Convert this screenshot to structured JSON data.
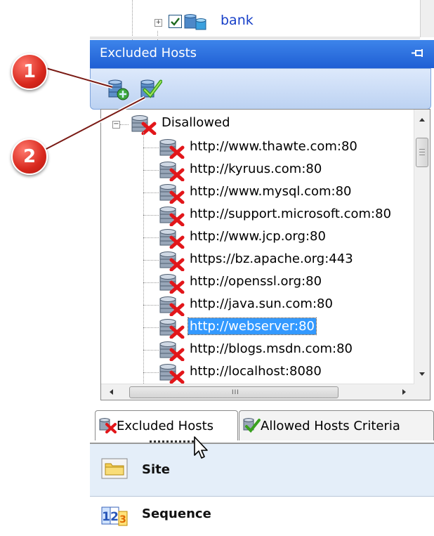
{
  "top_tree": {
    "node_label": "bank",
    "expander": "+"
  },
  "panel": {
    "title": "Excluded Hosts",
    "pin_icon": "pin-icon"
  },
  "toolbar": {
    "buttons": [
      {
        "icon": "add-host-icon"
      },
      {
        "icon": "allow-host-icon"
      }
    ]
  },
  "tree": {
    "root_label": "Disallowed",
    "expander": "−",
    "items": [
      {
        "label": "http://www.thawte.com:80",
        "selected": false
      },
      {
        "label": "http://kyruus.com:80",
        "selected": false
      },
      {
        "label": "http://www.mysql.com:80",
        "selected": false
      },
      {
        "label": "http://support.microsoft.com:80",
        "selected": false
      },
      {
        "label": "http://www.jcp.org:80",
        "selected": false
      },
      {
        "label": "https://bz.apache.org:443",
        "selected": false
      },
      {
        "label": "http://openssl.org:80",
        "selected": false
      },
      {
        "label": "http://java.sun.com:80",
        "selected": false
      },
      {
        "label": "http://webserver:80",
        "selected": true
      },
      {
        "label": "http://blogs.msdn.com:80",
        "selected": false
      },
      {
        "label": "http://localhost:8080",
        "selected": false
      }
    ],
    "hscroll_grip": "III"
  },
  "tabs": [
    {
      "label": "Excluded Hosts",
      "active": true
    },
    {
      "label": "Allowed Hosts Criteria",
      "active": false
    }
  ],
  "nav": {
    "site_label": "Site",
    "sequence_label": "Sequence"
  },
  "callouts": [
    "1",
    "2"
  ],
  "colors": {
    "header_blue": "#1f5fd4",
    "selection_blue": "#3399ff",
    "callout_red": "#d8281d",
    "link_blue": "#1840c8"
  }
}
